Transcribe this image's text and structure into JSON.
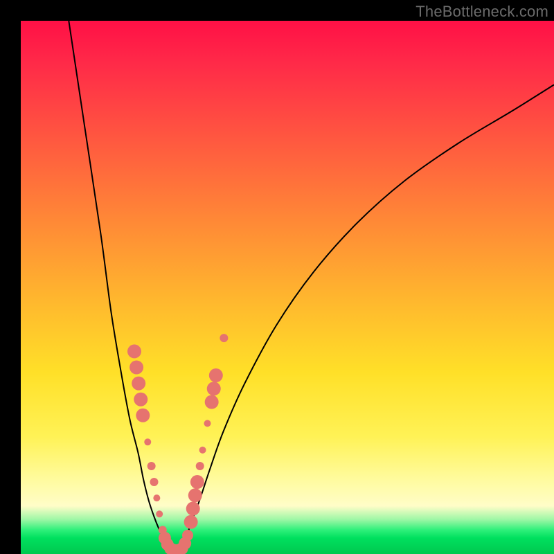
{
  "watermark": "TheBottleneck.com",
  "chart_data": {
    "type": "line",
    "title": "",
    "xlabel": "",
    "ylabel": "",
    "xlim": [
      0,
      100
    ],
    "ylim": [
      0,
      100
    ],
    "grid": false,
    "legend": false,
    "note": "Bottleneck-style V curve over a red→green gradient. Axes are unlabeled; values are approximate positions in % of plot area (0,0 = top-left).",
    "series": [
      {
        "name": "left-branch",
        "color": "#000000",
        "x": [
          9,
          12,
          15,
          17,
          19,
          20.5,
          22,
          23,
          24,
          25,
          26,
          27,
          27.8
        ],
        "y": [
          0,
          20,
          40,
          55,
          67,
          75,
          81,
          86,
          90,
          93,
          95.5,
          97.5,
          99
        ]
      },
      {
        "name": "right-branch",
        "color": "#000000",
        "x": [
          30.2,
          31,
          32,
          33.5,
          35.5,
          38,
          42,
          48,
          55,
          63,
          72,
          82,
          92,
          100
        ],
        "y": [
          99,
          97,
          94,
          90,
          84,
          77,
          68,
          57,
          47,
          38,
          30,
          23,
          17,
          12
        ]
      }
    ],
    "points": {
      "name": "highlighted-dots",
      "color": "#e6736f",
      "radius_small": 5,
      "radius_large": 10,
      "coords": [
        {
          "x": 21.3,
          "y": 62.0,
          "r": 10
        },
        {
          "x": 21.7,
          "y": 65.0,
          "r": 10
        },
        {
          "x": 22.1,
          "y": 68.0,
          "r": 10
        },
        {
          "x": 22.5,
          "y": 71.0,
          "r": 10
        },
        {
          "x": 22.9,
          "y": 74.0,
          "r": 10
        },
        {
          "x": 23.8,
          "y": 79.0,
          "r": 5
        },
        {
          "x": 24.5,
          "y": 83.5,
          "r": 6
        },
        {
          "x": 25.0,
          "y": 86.5,
          "r": 6
        },
        {
          "x": 25.5,
          "y": 89.5,
          "r": 5
        },
        {
          "x": 26.0,
          "y": 92.5,
          "r": 5
        },
        {
          "x": 26.6,
          "y": 95.5,
          "r": 6
        },
        {
          "x": 27.0,
          "y": 97.0,
          "r": 9
        },
        {
          "x": 27.5,
          "y": 98.2,
          "r": 9
        },
        {
          "x": 28.1,
          "y": 99.0,
          "r": 9
        },
        {
          "x": 28.8,
          "y": 99.3,
          "r": 9
        },
        {
          "x": 29.5,
          "y": 99.3,
          "r": 9
        },
        {
          "x": 30.2,
          "y": 99.0,
          "r": 9
        },
        {
          "x": 30.8,
          "y": 98.0,
          "r": 9
        },
        {
          "x": 31.3,
          "y": 96.5,
          "r": 8
        },
        {
          "x": 31.9,
          "y": 94.0,
          "r": 10
        },
        {
          "x": 32.3,
          "y": 91.5,
          "r": 10
        },
        {
          "x": 32.7,
          "y": 89.0,
          "r": 10
        },
        {
          "x": 33.1,
          "y": 86.5,
          "r": 10
        },
        {
          "x": 33.6,
          "y": 83.5,
          "r": 6
        },
        {
          "x": 34.1,
          "y": 80.5,
          "r": 5
        },
        {
          "x": 35.0,
          "y": 75.5,
          "r": 5
        },
        {
          "x": 35.8,
          "y": 71.5,
          "r": 10
        },
        {
          "x": 36.2,
          "y": 69.0,
          "r": 10
        },
        {
          "x": 36.6,
          "y": 66.5,
          "r": 10
        },
        {
          "x": 38.1,
          "y": 59.5,
          "r": 6
        }
      ]
    }
  }
}
